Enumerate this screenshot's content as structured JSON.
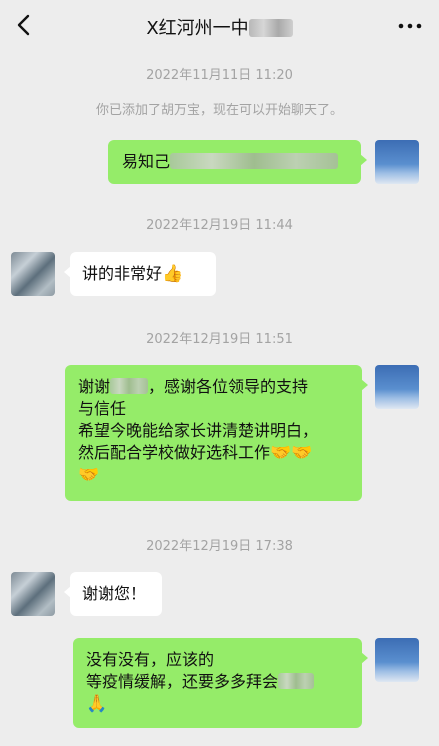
{
  "header": {
    "title": "X红河州一中",
    "back_icon": "chevron-left-icon",
    "more_icon": "more-dots-icon"
  },
  "messages": [
    {
      "type": "timestamp",
      "text": "2022年11月11日 11:20"
    },
    {
      "type": "system",
      "text": "你已添加了胡万宝，现在可以开始聊天了。"
    },
    {
      "type": "sent",
      "text": "易知己"
    },
    {
      "type": "timestamp",
      "text": "2022年12月19日 11:44"
    },
    {
      "type": "received",
      "text": "讲的非常好",
      "emoji": "👍"
    },
    {
      "type": "timestamp",
      "text": "2022年12月19日 11:51"
    },
    {
      "type": "sent",
      "line1a": "谢谢",
      "line1b": "，感谢各位领导的支持",
      "line2": "与信任",
      "line3": "希望今晚能给家长讲清楚讲明白，",
      "line4": "然后配合学校做好选科工作",
      "emoji": "🤝"
    },
    {
      "type": "timestamp",
      "text": "2022年12月19日 17:38"
    },
    {
      "type": "received",
      "text": "谢谢您！"
    },
    {
      "type": "sent",
      "line1": "没有没有，应该的",
      "line2": "等疫情缓解，还要多多拜会",
      "emoji": "🙏"
    }
  ],
  "colors": {
    "background": "#ededed",
    "sent_bubble": "#95ec69",
    "received_bubble": "#ffffff",
    "timestamp_text": "#a3a3a3"
  }
}
